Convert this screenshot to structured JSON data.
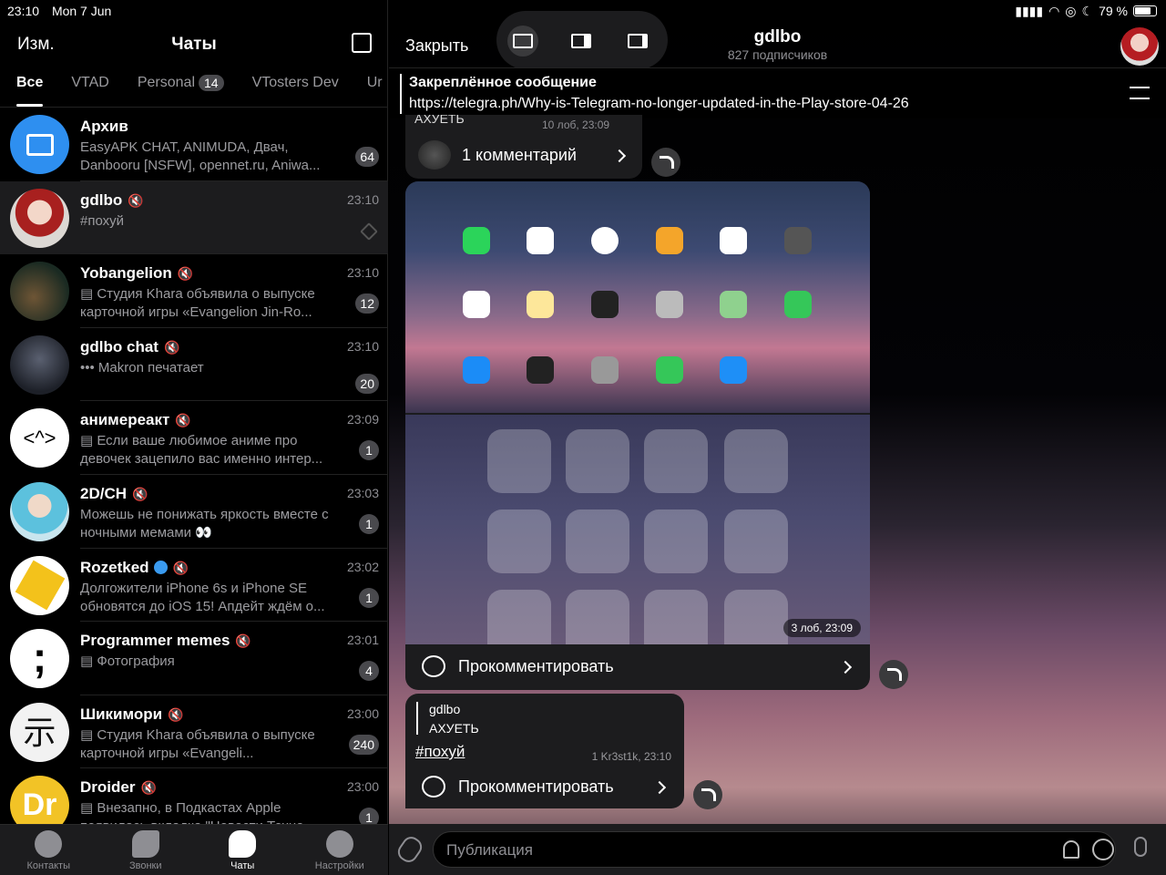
{
  "status": {
    "time": "23:10",
    "date": "Mon 7 Jun",
    "battery": "79 %"
  },
  "left_header": {
    "edit": "Изм.",
    "title": "Чаты"
  },
  "folders": [
    {
      "label": "Все",
      "active": true
    },
    {
      "label": "VTAD"
    },
    {
      "label": "Personal",
      "badge": "14"
    },
    {
      "label": "VTosters Dev"
    },
    {
      "label": "Ur"
    }
  ],
  "chats": [
    {
      "name": "Архив",
      "time": "",
      "msg": "EasyAPK CHAT, ANIMUDA, Двач, Danbooru [NSFW], opennet.ru, Aniwa...",
      "unread": "64",
      "color": "#3b8fe8",
      "muted": false
    },
    {
      "name": "gdlbo",
      "time": "23:10",
      "msg": "#похуй",
      "unread": "",
      "pinned": true,
      "muted": true,
      "color": "#c44"
    },
    {
      "name": "Yobangelion",
      "time": "23:10",
      "msg": "▤ Студия Khara объявила о выпуске карточной игры «Evangelion Jin-Ro...",
      "unread": "12",
      "muted": true,
      "color": "#314a3a"
    },
    {
      "name": "gdlbo chat",
      "time": "23:10",
      "msg": "••• Makron печатает",
      "unread": "20",
      "muted": true,
      "color": "#2e3340"
    },
    {
      "name": "анимереакт",
      "time": "23:09",
      "msg": "▤ Если ваше любимое аниме про девочек зацепило вас именно интер...",
      "unread": "1",
      "muted": true,
      "color": "#fff"
    },
    {
      "name": "2D/CH",
      "time": "23:03",
      "msg": "Можешь не понижать яркость вместе с  ночными мемами 👀",
      "unread": "1",
      "muted": true,
      "color": "#6cc0d8"
    },
    {
      "name": "Rozetked",
      "time": "23:02",
      "msg": "Долгожители iPhone 6s и iPhone SE обновятся до iOS 15! Апдейт ждём о...",
      "unread": "1",
      "muted": true,
      "verified": true,
      "color": "#f3c21b"
    },
    {
      "name": "Programmer memes",
      "time": "23:01",
      "msg": "▤ Фотография",
      "unread": "4",
      "muted": true,
      "color": "#fff"
    },
    {
      "name": "Шикимори",
      "time": "23:00",
      "msg": "▤ Студия Khara объявила о выпуске карточной игры «Evangeli...",
      "unread": "240",
      "muted": true,
      "color": "#f2f2f2"
    },
    {
      "name": "Droider",
      "time": "23:00",
      "msg": "▤ Внезапно, в Подкастах Apple появилась вкладка \"Новости Техно...",
      "unread": "1",
      "muted": true,
      "color": "#f2c326"
    }
  ],
  "tabs": [
    {
      "label": "Контакты"
    },
    {
      "label": "Звонки"
    },
    {
      "label": "Чаты",
      "active": true
    },
    {
      "label": "Настройки"
    }
  ],
  "right_header": {
    "close": "Закрыть",
    "channel": "gdlbo",
    "subscribers": "827 подписчиков"
  },
  "pinned": {
    "title": "Закреплённое сообщение",
    "text": "https://telegra.ph/Why-is-Telegram-no-longer-updated-in-the-Play-store-04-26"
  },
  "msg1": {
    "top_text": "АХУЕТЬ",
    "views": "10 лоб, 23:09",
    "comments": "1 комментарий"
  },
  "msg2": {
    "meta": "3 лоб, 23:09",
    "comment": "Прокомментировать"
  },
  "msg3": {
    "quote_author": "gdlbo",
    "quote_text": "АХУЕТЬ",
    "hashtag": "#похуй",
    "meta": "1 Kr3st1k, 23:10",
    "comment": "Прокомментировать"
  },
  "composer": {
    "placeholder": "Публикация"
  }
}
